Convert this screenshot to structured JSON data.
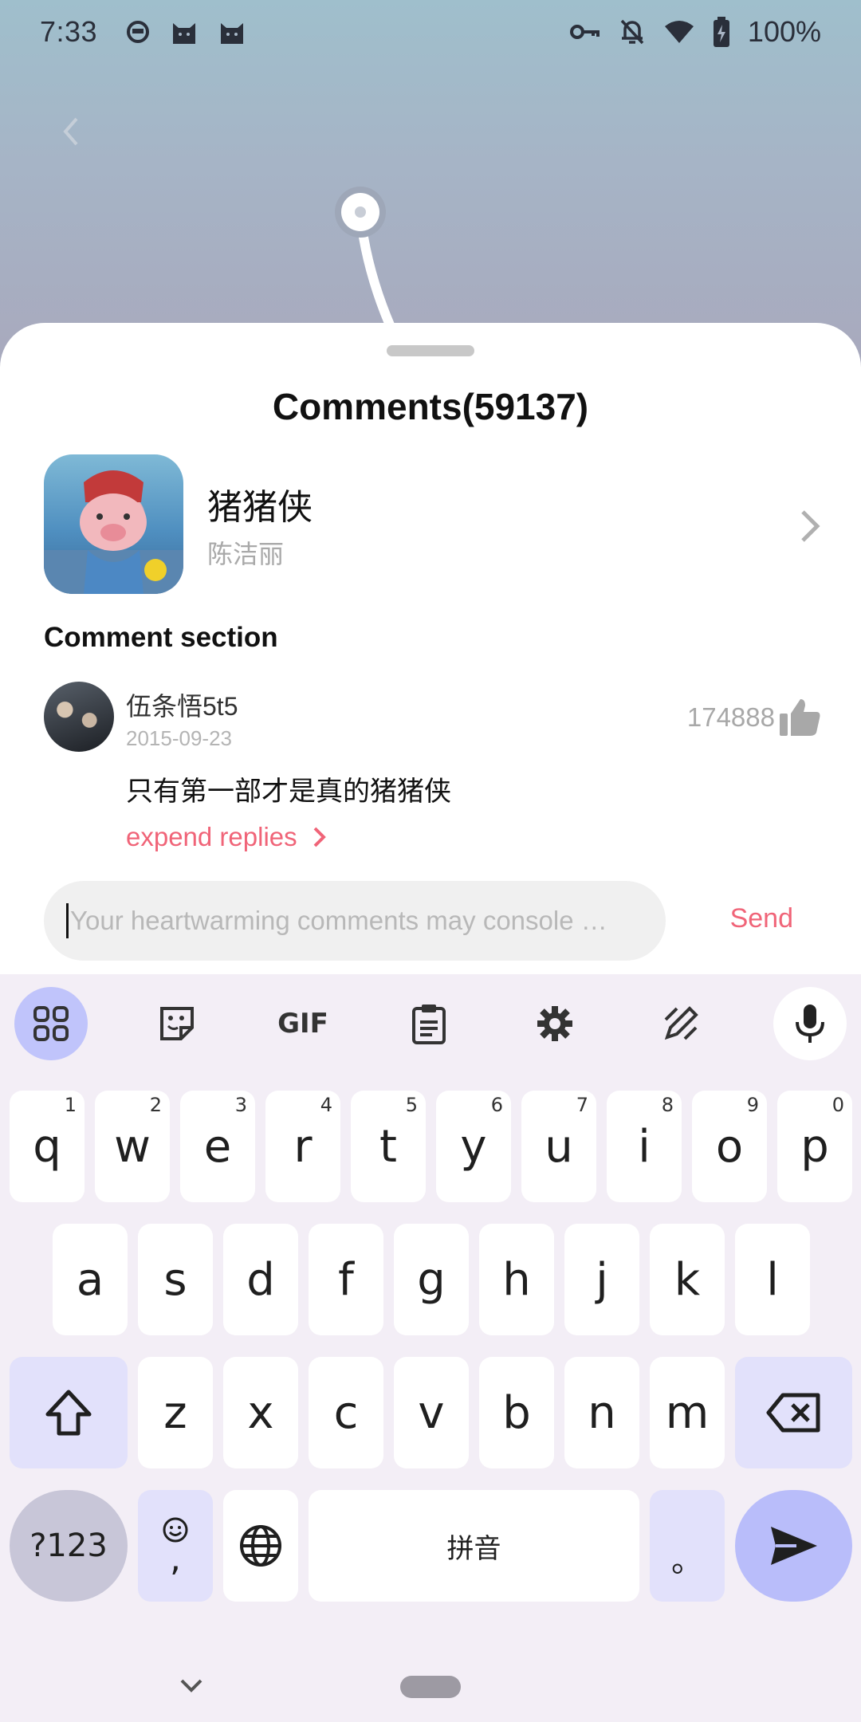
{
  "status_bar": {
    "time": "7:33",
    "battery": "100%",
    "icons": [
      "assistant-icon",
      "cat-icon",
      "cat-icon",
      "key-icon",
      "bell-off-icon",
      "wifi-icon",
      "battery-icon"
    ]
  },
  "sheet": {
    "title": "Comments(59137)",
    "video": {
      "title": "猪猪侠",
      "author": "陈洁丽"
    },
    "section_title": "Comment section",
    "comments": [
      {
        "user": "伍条悟5t5",
        "date": "2015-09-23",
        "text": "只有第一部才是真的猪猪侠",
        "likes": "174888",
        "expand_label": "expend replies"
      }
    ],
    "input": {
      "placeholder": "Your heartwarming comments may console …",
      "value": ""
    },
    "send_label": "Send"
  },
  "keyboard": {
    "toolbar": [
      "apps-icon",
      "sticker-icon",
      "GIF",
      "clipboard-icon",
      "settings-icon",
      "handwriting-icon",
      "mic-icon"
    ],
    "gif_label": "GIF",
    "row1": [
      {
        "k": "q",
        "h": "1"
      },
      {
        "k": "w",
        "h": "2"
      },
      {
        "k": "e",
        "h": "3"
      },
      {
        "k": "r",
        "h": "4"
      },
      {
        "k": "t",
        "h": "5"
      },
      {
        "k": "y",
        "h": "6"
      },
      {
        "k": "u",
        "h": "7"
      },
      {
        "k": "i",
        "h": "8"
      },
      {
        "k": "o",
        "h": "9"
      },
      {
        "k": "p",
        "h": "0"
      }
    ],
    "row2": [
      "a",
      "s",
      "d",
      "f",
      "g",
      "h",
      "j",
      "k",
      "l"
    ],
    "row3": [
      "z",
      "x",
      "c",
      "v",
      "b",
      "n",
      "m"
    ],
    "symbols_label": "?123",
    "comma_label": ",",
    "space_label": "拼音",
    "period_label": "。"
  }
}
